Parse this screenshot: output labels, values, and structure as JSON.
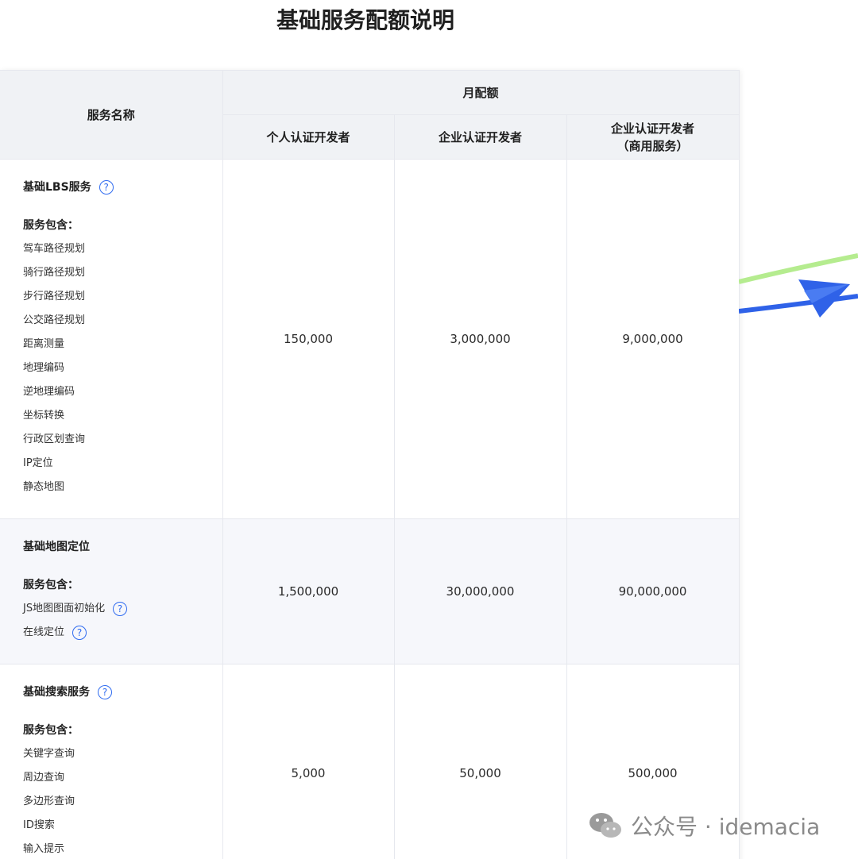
{
  "page": {
    "title": "基础服务配额说明"
  },
  "table": {
    "col_service": "服务名称",
    "col_monthly": "月配额",
    "sub_headers": [
      "个人认证开发者",
      "企业认证开发者",
      "企业认证开发者",
      "（商用服务）"
    ],
    "rows": [
      {
        "name": "基础LBS服务",
        "includes_label": "服务包含：",
        "items": [
          "驾车路径规划",
          "骑行路径规划",
          "步行路径规划",
          "公交路径规划",
          "距离测量",
          "地理编码",
          "逆地理编码",
          "坐标转换",
          "行政区划查询",
          "IP定位",
          "静态地图"
        ],
        "values": [
          "150,000",
          "3,000,000",
          "9,000,000"
        ]
      },
      {
        "name": "基础地图定位",
        "includes_label": "服务包含：",
        "items": [
          "JS地图图面初始化",
          "在线定位"
        ],
        "values": [
          "1,500,000",
          "30,000,000",
          "90,000,000"
        ]
      },
      {
        "name": "基础搜索服务",
        "includes_label": "服务包含：",
        "items": [
          "关键字查询",
          "周边查询",
          "多边形查询",
          "ID搜索",
          "输入提示"
        ],
        "values": [
          "5,000",
          "50,000",
          "500,000"
        ]
      }
    ]
  },
  "help_icon_glyph": "?",
  "watermark": {
    "text": "公众号 · idemacia"
  },
  "colors": {
    "accent": "#2f6bf0",
    "header_bg": "#f0f2f5",
    "alt_row_bg": "#f6f7fb",
    "line_green": "#b5ec8f",
    "line_blue": "#2f62e8"
  }
}
